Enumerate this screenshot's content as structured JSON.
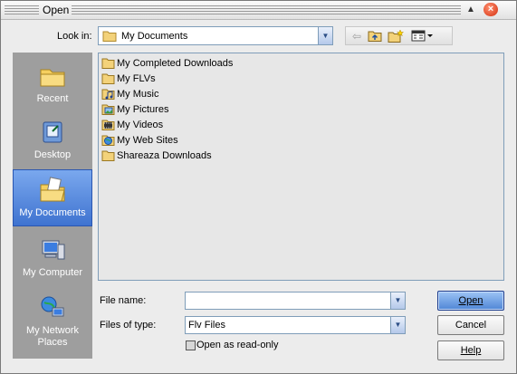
{
  "window": {
    "title": "Open"
  },
  "look_in": {
    "label": "Look in:",
    "value": "My Documents"
  },
  "places": [
    {
      "label": "Recent",
      "icon": "recent-folder-icon",
      "selected": false
    },
    {
      "label": "Desktop",
      "icon": "desktop-icon",
      "selected": false
    },
    {
      "label": "My Documents",
      "icon": "my-documents-icon",
      "selected": true
    },
    {
      "label": "My Computer",
      "icon": "my-computer-icon",
      "selected": false
    },
    {
      "label": "My Network Places",
      "icon": "network-places-icon",
      "selected": false
    }
  ],
  "files": [
    {
      "name": "My Completed Downloads",
      "icon": "folder-icon"
    },
    {
      "name": "My FLVs",
      "icon": "folder-icon"
    },
    {
      "name": "My Music",
      "icon": "music-folder-icon"
    },
    {
      "name": "My Pictures",
      "icon": "pictures-folder-icon"
    },
    {
      "name": "My Videos",
      "icon": "videos-folder-icon"
    },
    {
      "name": "My Web Sites",
      "icon": "web-sites-folder-icon"
    },
    {
      "name": "Shareaza Downloads",
      "icon": "folder-icon"
    }
  ],
  "file_name": {
    "label": "File name:",
    "value": ""
  },
  "file_type": {
    "label": "Files of type:",
    "value": "Flv Files"
  },
  "read_only": {
    "label": "Open as read-only",
    "checked": false
  },
  "buttons": {
    "open": "Open",
    "cancel": "Cancel",
    "help": "Help"
  },
  "colors": {
    "accent": "#4f86d6",
    "places_bg": "#9e9e9e",
    "list_bg": "#e7e7e7"
  }
}
